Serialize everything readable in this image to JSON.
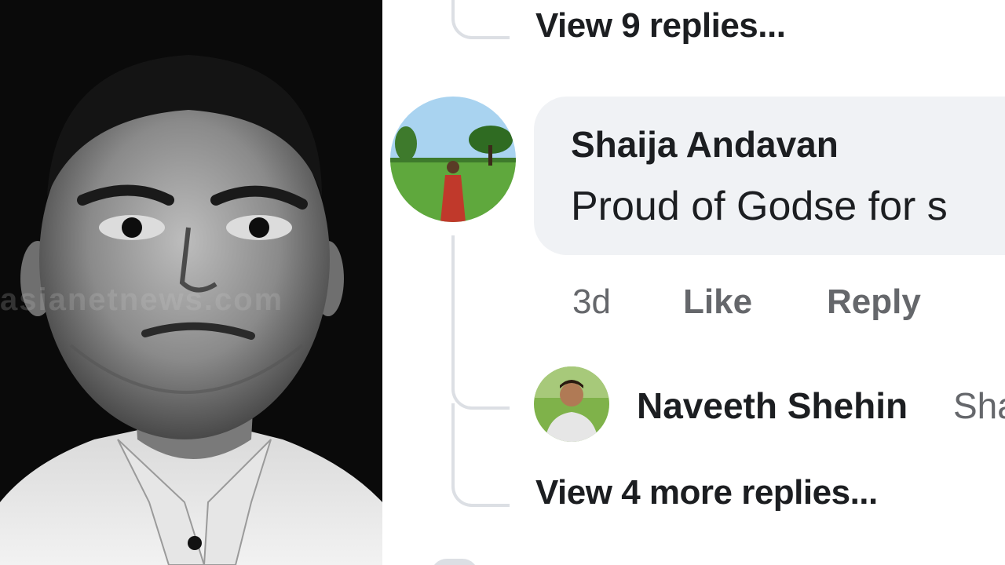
{
  "thread": {
    "view_replies_top": "View 9 replies...",
    "comment": {
      "author": "Shaija Andavan",
      "text": "Proud of Godse for s",
      "time": "3d",
      "like_label": "Like",
      "reply_label": "Reply"
    },
    "reply_preview": {
      "author": "Naveeth Shehin",
      "text": "Sha"
    },
    "view_more_replies": "View 4 more replies..."
  },
  "watermark": "asianetnews.com",
  "icons": {
    "commenter_avatar": "profile-photo-icon",
    "reply_avatar": "profile-photo-icon"
  },
  "colors": {
    "bubble": "#f0f2f5",
    "text_primary": "#1c1e21",
    "text_secondary": "#65676b",
    "thread_line": "#dcdfe4"
  }
}
